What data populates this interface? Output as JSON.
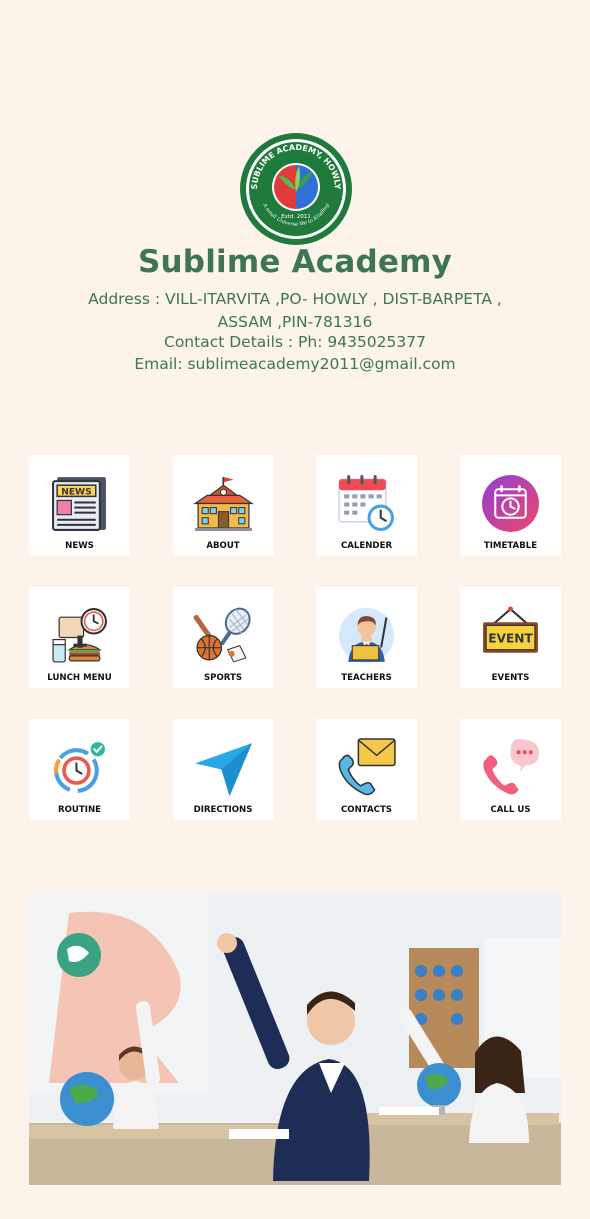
{
  "school": {
    "name": "Sublime Academy",
    "logo_ring_text": "SUBLIME ACADEMY, HOWLY",
    "logo_estd": "Estd. 2011",
    "logo_motto": "A small Universe We to Kindling",
    "address_line1": "Address : VILL-ITARVITA ,PO- HOWLY , DIST-BARPETA ,",
    "address_line2": "ASSAM ,PIN-781316",
    "contact": "Contact Details : Ph: 9435025377",
    "email": "Email: sublimeacademy2011@gmail.com"
  },
  "menu": [
    {
      "label": "NEWS",
      "icon": "newspaper-icon"
    },
    {
      "label": "ABOUT",
      "icon": "school-building-icon"
    },
    {
      "label": "CALENDER",
      "icon": "calendar-clock-icon"
    },
    {
      "label": "TIMETABLE",
      "icon": "timetable-clock-icon"
    },
    {
      "label": "LUNCH MENU",
      "icon": "lunch-icon"
    },
    {
      "label": "SPORTS",
      "icon": "sports-icon"
    },
    {
      "label": "TEACHERS",
      "icon": "teacher-icon"
    },
    {
      "label": "EVENTS",
      "icon": "event-sign-icon"
    },
    {
      "label": "ROUTINE",
      "icon": "routine-clock-icon"
    },
    {
      "label": "DIRECTIONS",
      "icon": "navigation-arrow-icon"
    },
    {
      "label": "CONTACTS",
      "icon": "phone-mail-icon"
    },
    {
      "label": "CALL US",
      "icon": "call-us-icon"
    }
  ],
  "event_sign_text": "EVENT",
  "news_icon_text": "NEWS",
  "colors": {
    "background": "#fcf4ea",
    "brand_green": "#3e7553",
    "tile": "#ffffff"
  }
}
